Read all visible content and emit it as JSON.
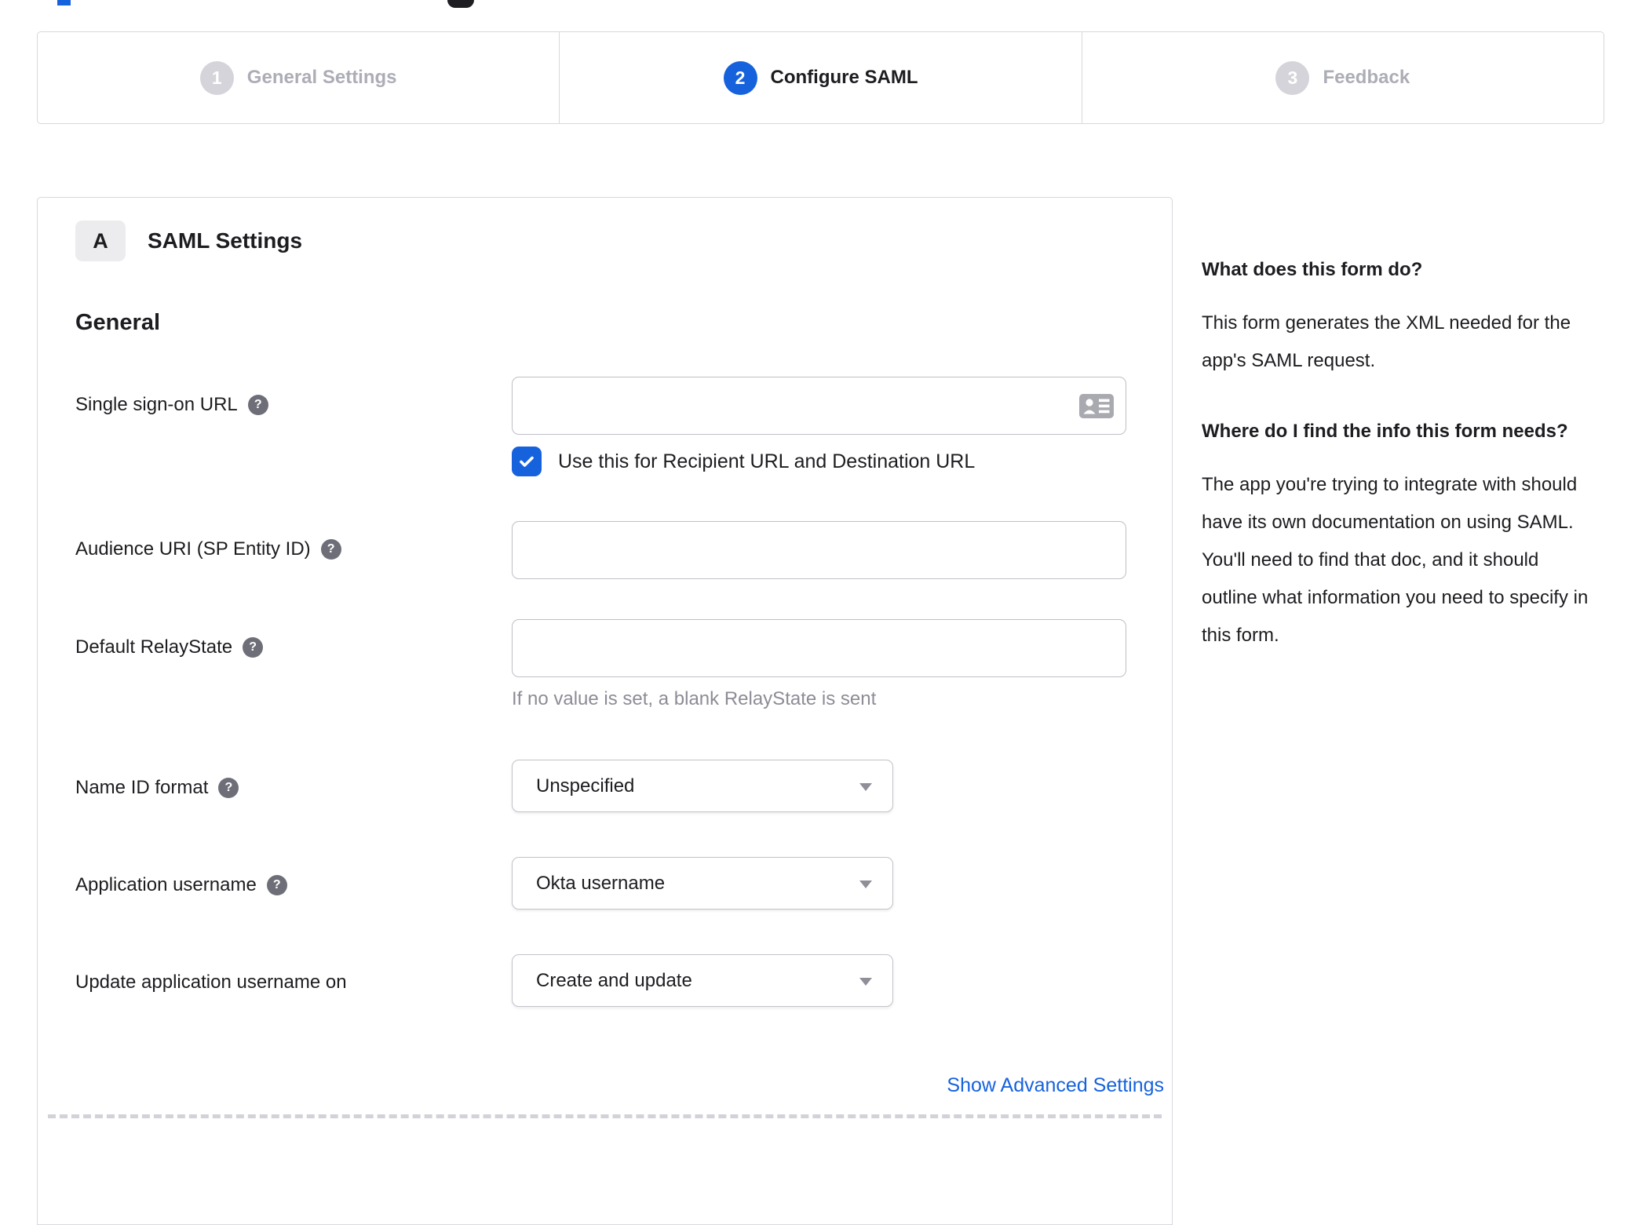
{
  "stepper": {
    "steps": [
      {
        "number": "1",
        "label": "General Settings",
        "state": "inactive"
      },
      {
        "number": "2",
        "label": "Configure SAML",
        "state": "active"
      },
      {
        "number": "3",
        "label": "Feedback",
        "state": "inactive"
      }
    ]
  },
  "panel": {
    "section_badge": "A",
    "section_title": "SAML Settings",
    "group_title": "General",
    "fields": [
      {
        "label": "Single sign-on URL",
        "type": "text",
        "value": "",
        "has_help": true,
        "checkbox": {
          "checked": true,
          "label": "Use this for Recipient URL and Destination URL"
        }
      },
      {
        "label": "Audience URI (SP Entity ID)",
        "type": "text",
        "value": "",
        "has_help": true
      },
      {
        "label": "Default RelayState",
        "type": "text",
        "value": "",
        "has_help": true,
        "helper": "If no value is set, a blank RelayState is sent"
      },
      {
        "label": "Name ID format",
        "type": "select",
        "value": "Unspecified",
        "has_help": true
      },
      {
        "label": "Application username",
        "type": "select",
        "value": "Okta username",
        "has_help": true
      },
      {
        "label": "Update application username on",
        "type": "select",
        "value": "Create and update",
        "has_help": false
      }
    ],
    "advanced_link": "Show Advanced Settings"
  },
  "help_sidebar": {
    "sections": [
      {
        "heading": "What does this form do?",
        "body": "This form generates the XML needed for the app's SAML request."
      },
      {
        "heading": "Where do I find the info this form needs?",
        "body": "The app you're trying to integrate with should have its own documentation on using SAML. You'll need to find that doc, and it should outline what information you need to specify in this form."
      }
    ]
  },
  "icons": {
    "help": "question-mark-icon",
    "single_sign_on_input": "contact-card-icon",
    "checkbox": "checkmark-icon",
    "select": "chevron-down-caret"
  },
  "colors": {
    "accent_blue": "#1662dd",
    "inactive_gray": "#adadb7",
    "text_dark": "#1d1d21",
    "helper_gray": "#8c8c96",
    "border_gray": "#d8d8de"
  }
}
